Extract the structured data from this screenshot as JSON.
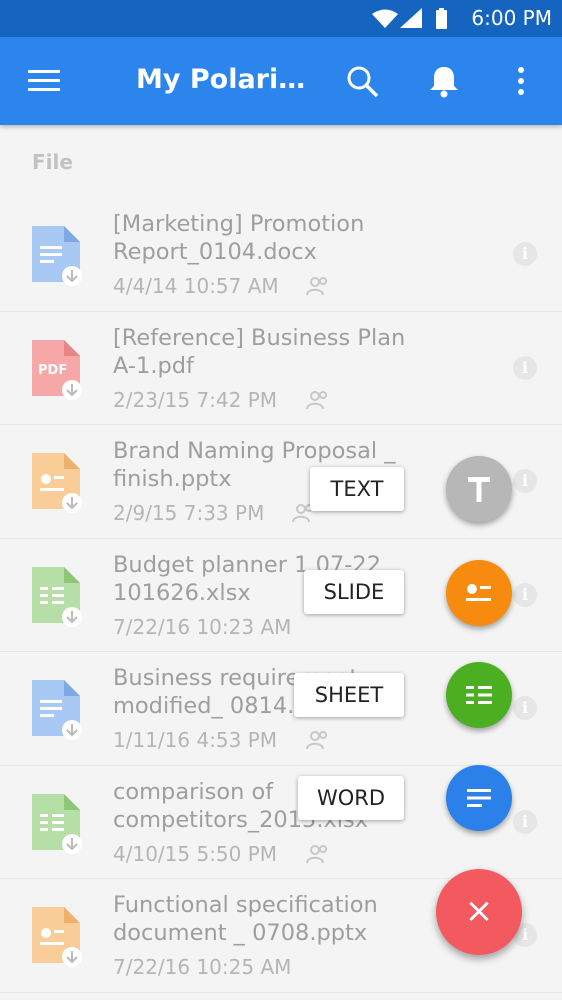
{
  "status": {
    "time": "6:00 PM"
  },
  "appbar": {
    "title": "My Polaris Office",
    "menu_icon": "menu-icon",
    "search_icon": "search-icon",
    "notification_icon": "bell-icon",
    "more_icon": "more-vert-icon"
  },
  "section": {
    "label": "File"
  },
  "files": [
    {
      "name": "[Marketing] Promotion Report_0104.docx",
      "date": "4/4/14 10:57 AM",
      "type": "word",
      "shared": true
    },
    {
      "name": "[Reference] Business Plan A-1.pdf",
      "date": "2/23/15 7:42 PM",
      "type": "pdf",
      "shared": true
    },
    {
      "name": "Brand Naming Proposal _ finish.pptx",
      "date": "2/9/15 7:33 PM",
      "type": "slide",
      "shared": true
    },
    {
      "name": "Budget planner 1 07-22 101626.xlsx",
      "date": "7/22/16 10:23 AM",
      "type": "sheet",
      "shared": false
    },
    {
      "name": "Business requirement modified_ 0814.docx",
      "date": "1/11/16 4:53 PM",
      "type": "word",
      "shared": true
    },
    {
      "name": "comparison of competitors_2015.xlsx",
      "date": "4/10/15 5:50 PM",
      "type": "sheet",
      "shared": true
    },
    {
      "name": "Functional specification document _ 0708.pptx",
      "date": "7/22/16 10:25 AM",
      "type": "slide",
      "shared": false
    }
  ],
  "fab_menu": {
    "text_label": "TEXT",
    "slide_label": "SLIDE",
    "sheet_label": "SHEET",
    "word_label": "WORD",
    "close_symbol": "×"
  },
  "colors": {
    "appbar": "#2b85ec",
    "statusbar": "#1565c0",
    "text_fab": "#b7b7b7",
    "slide_fab": "#f68b0f",
    "sheet_fab": "#4caf21",
    "word_fab": "#2b80ea",
    "close_fab": "#f35a5f"
  }
}
